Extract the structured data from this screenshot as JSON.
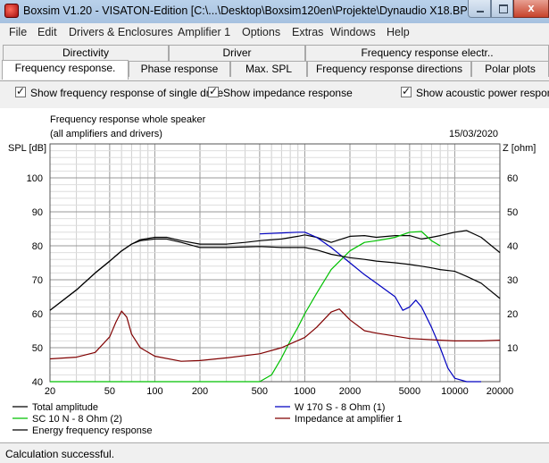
{
  "window": {
    "title": "Boxsim V1.20 - VISATON-Edition [C:\\...\\Desktop\\Boxsim120en\\Projekte\\Dynaudio X18.BPJ]",
    "close_glyph": "x"
  },
  "menu": [
    "File",
    "Edit",
    "Drivers & Enclosures",
    "Amplifier 1",
    "Options",
    "Extras",
    "Windows",
    "Help"
  ],
  "tabs_back": [
    "Directivity",
    "Driver",
    "Frequency response electr.."
  ],
  "tabs_front": [
    "Frequency response.",
    "Phase response",
    "Max. SPL",
    "Frequency response directions",
    "Polar plots"
  ],
  "checkboxes": [
    {
      "label": "Show frequency response of single drive",
      "checked": true
    },
    {
      "label": "Show impedance response",
      "checked": true
    },
    {
      "label": "Show acoustic power respons",
      "checked": true
    }
  ],
  "chart_data": {
    "type": "line",
    "title": "Frequency response whole speaker",
    "subtitle": "(all amplifiers and drivers)",
    "date": "15/03/2020",
    "ylabel_left": "SPL [dB]",
    "ylabel_right": "Z [ohm]",
    "x_scale": "log",
    "xlim": [
      20,
      20000
    ],
    "ylim_left": [
      40,
      110
    ],
    "ylim_right": [
      0,
      70
    ],
    "x_ticks": [
      "20",
      "50",
      "100",
      "200",
      "500",
      "1000",
      "2000",
      "5000",
      "10000",
      "20000"
    ],
    "y_ticks_left": [
      "40",
      "50",
      "60",
      "70",
      "80",
      "90",
      "100"
    ],
    "y_ticks_right": [
      "10",
      "20",
      "30",
      "40",
      "50",
      "60"
    ],
    "grid": true,
    "legend_position": "bottom",
    "series": [
      {
        "name": "Total amplitude",
        "color": "#000000",
        "axis": "left",
        "x": [
          20,
          30,
          40,
          50,
          60,
          70,
          80,
          100,
          120,
          150,
          200,
          300,
          400,
          500,
          700,
          900,
          1000,
          1200,
          1500,
          2000,
          2500,
          3000,
          4000,
          5000,
          6000,
          7000,
          8000,
          10000,
          12000,
          15000,
          20000
        ],
        "y": [
          61,
          67,
          72,
          75.5,
          78.5,
          80.5,
          81.8,
          82.5,
          82.5,
          81.5,
          80.5,
          80.5,
          81,
          81.5,
          82,
          82.8,
          83.2,
          82.5,
          81,
          82.8,
          83,
          82.5,
          83,
          83,
          82,
          82.5,
          83,
          84,
          84.5,
          82.5,
          78
        ]
      },
      {
        "name": "W 170 S - 8 Ohm (1)",
        "color": "#0000c0",
        "axis": "left",
        "x": [
          500,
          700,
          900,
          1000,
          1200,
          1500,
          2000,
          2500,
          3000,
          4000,
          4500,
          5000,
          5500,
          6000,
          7000,
          8000,
          9000,
          10000,
          12000,
          15000
        ],
        "y": [
          83.5,
          83.8,
          84,
          84,
          82.5,
          79.5,
          75,
          71.5,
          69,
          65,
          61,
          62,
          64,
          62,
          56,
          50,
          44,
          41,
          40,
          40
        ]
      },
      {
        "name": "SC 10 N - 8 Ohm (2)",
        "color": "#00c000",
        "axis": "left",
        "x": [
          20,
          500,
          600,
          700,
          800,
          900,
          1000,
          1200,
          1500,
          2000,
          2500,
          3000,
          3500,
          4000,
          5000,
          6000,
          7000,
          8000
        ],
        "y": [
          40,
          40,
          42,
          47,
          52,
          56,
          60,
          66,
          73,
          78.5,
          81,
          81.5,
          82,
          82.5,
          84,
          84.2,
          81.5,
          80
        ]
      },
      {
        "name": "Impedance at amplifier 1",
        "color": "#800000",
        "axis": "right",
        "x": [
          20,
          30,
          40,
          50,
          55,
          60,
          65,
          70,
          80,
          100,
          150,
          200,
          300,
          500,
          700,
          1000,
          1200,
          1500,
          1700,
          2000,
          2500,
          3000,
          5000,
          8000,
          10000,
          15000,
          20000
        ],
        "y": [
          6.7,
          7.2,
          8.6,
          13.2,
          17.5,
          20.8,
          19,
          14,
          10,
          7.5,
          6,
          6.2,
          7,
          8.2,
          10,
          13,
          16,
          20.5,
          21.4,
          18.2,
          15,
          14.3,
          12.7,
          12.2,
          12,
          12,
          12.2
        ]
      },
      {
        "name": "Energy frequency response",
        "color": "#000000",
        "axis": "left",
        "x": [
          20,
          30,
          40,
          50,
          60,
          70,
          80,
          100,
          120,
          150,
          200,
          300,
          500,
          700,
          1000,
          1200,
          1500,
          2000,
          2500,
          3000,
          4000,
          5000,
          6000,
          7000,
          8000,
          10000,
          12000,
          15000,
          20000
        ],
        "y": [
          61,
          67,
          72,
          75.5,
          78.5,
          80.5,
          81.5,
          82,
          82,
          81,
          79.5,
          79.5,
          79.8,
          79.5,
          79.5,
          78.8,
          77.5,
          76.5,
          76,
          75.5,
          75,
          74.5,
          74,
          73.5,
          73,
          72.5,
          71,
          69,
          64.5
        ]
      }
    ]
  },
  "legend": [
    "Total amplitude",
    "W 170 S - 8 Ohm (1)",
    "SC 10 N - 8 Ohm (2)",
    "Impedance at amplifier 1",
    "Energy frequency response"
  ],
  "status": "Calculation successful."
}
